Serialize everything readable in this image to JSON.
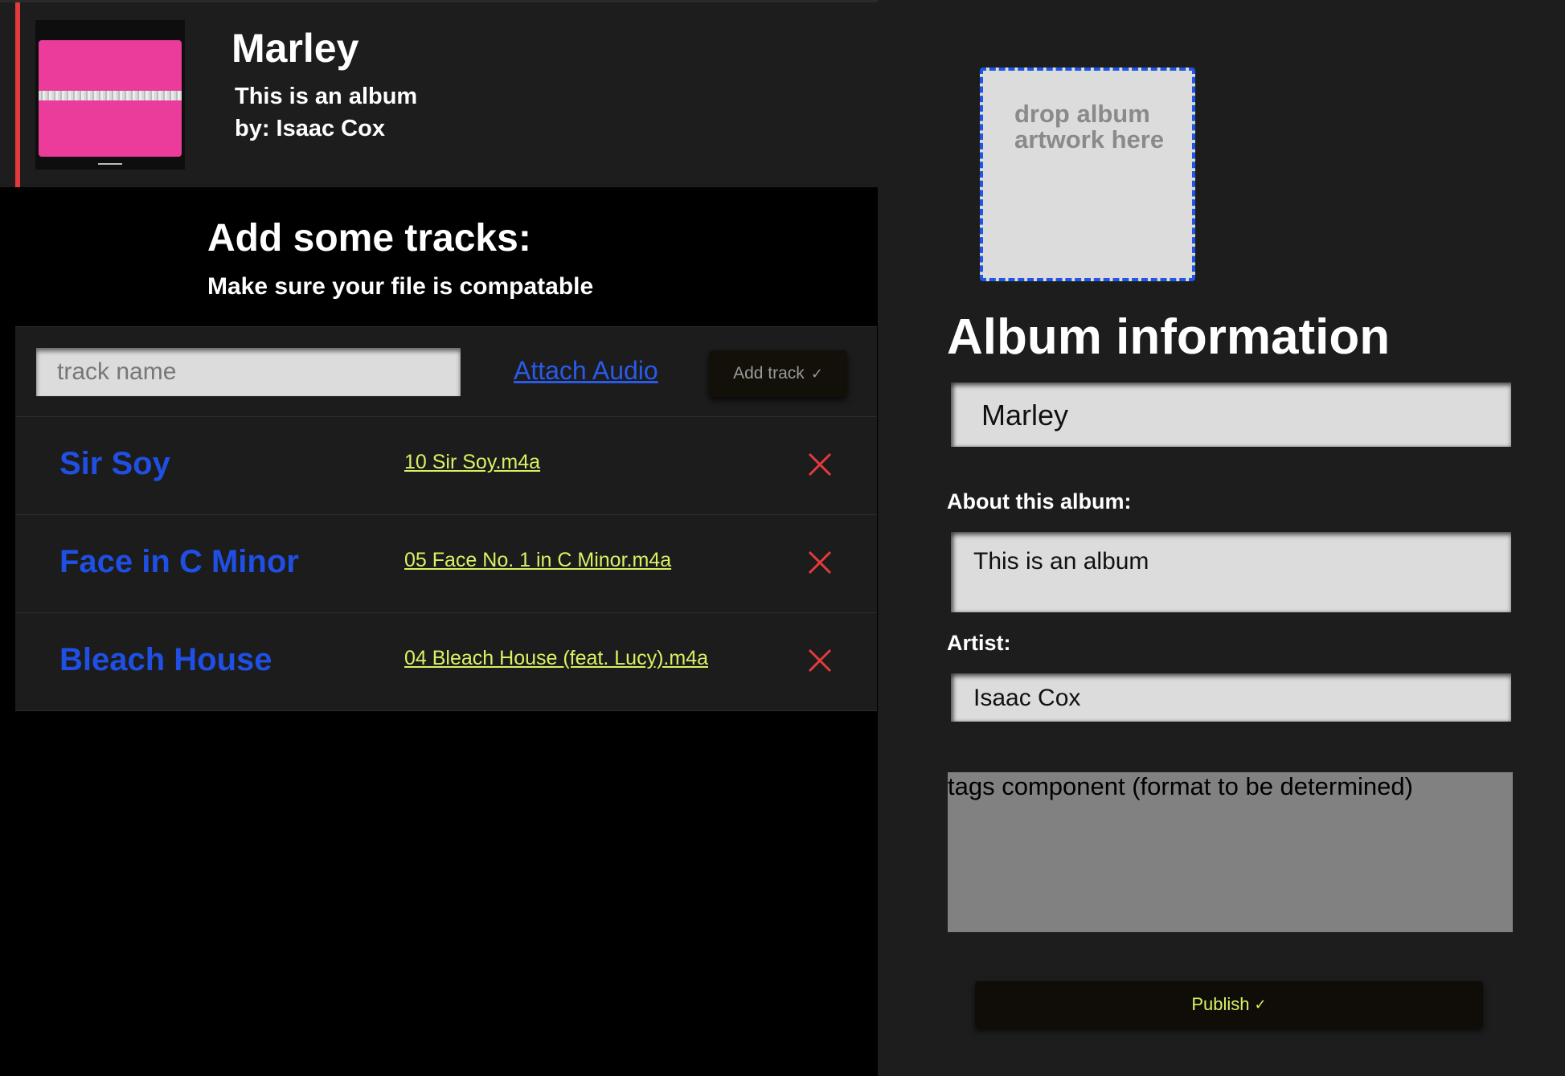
{
  "header": {
    "album_title": "Marley",
    "description": "This is an album",
    "artist_line": "by: Isaac Cox"
  },
  "tracks_panel": {
    "title": "Add some tracks:",
    "subtitle": "Make sure your file is compatable",
    "track_name_placeholder": "track name",
    "attach_audio_label": "Attach Audio",
    "add_track_label": "Add track",
    "tracks": [
      {
        "title": "Sir Soy",
        "file": "10 Sir Soy.m4a"
      },
      {
        "title": "Face in C Minor",
        "file": "05 Face No. 1 in C Minor.m4a"
      },
      {
        "title": "Bleach House",
        "file": "04 Bleach House (feat. Lucy).m4a"
      }
    ]
  },
  "album_info": {
    "artwork_drop_text": "drop album artwork here",
    "title": "Album information",
    "name_value": "Marley",
    "about_label": "About this album:",
    "about_value": "This is an album",
    "artist_label": "Artist:",
    "artist_value": "Isaac Cox",
    "tags_text": "tags component (format to be determined)",
    "publish_label": "Publish"
  },
  "icons": {
    "check": "check-icon",
    "remove": "close-icon"
  },
  "colors": {
    "accent_red": "#e33b3b",
    "link_blue": "#2a5ae8",
    "track_title_blue": "#1f4fe3",
    "file_link_yellow": "#d9f262",
    "drop_border_blue": "#1e57e6",
    "cover_pink": "#eb3b9b"
  }
}
